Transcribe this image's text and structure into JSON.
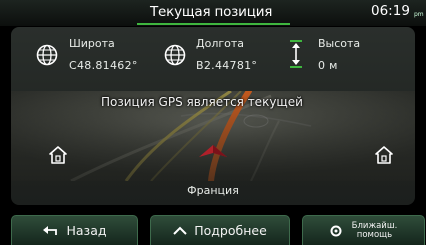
{
  "header": {
    "title": "Текущая позиция",
    "time": "06:19",
    "ampm": "pm"
  },
  "info": {
    "latitude": {
      "label": "Широта",
      "value": "C48.81462°",
      "icon": "globe-icon"
    },
    "longitude": {
      "label": "Долгота",
      "value": "B2.44781°",
      "icon": "globe-icon"
    },
    "altitude": {
      "label": "Высота",
      "value": "0 м",
      "icon": "altitude-arrows-icon"
    }
  },
  "map": {
    "status": "Позиция GPS является текущей",
    "country": "Франция",
    "left_icon": "home-icon",
    "right_icon": "home-icon",
    "position_icon": "vehicle-position-arrow-icon"
  },
  "buttons": {
    "back": {
      "label": "Назад",
      "icon": "back-arrow-icon"
    },
    "details": {
      "label": "Подробнее",
      "icon": "chevron-up-icon"
    },
    "nearby": {
      "label_line1": "Ближайш.",
      "label_line2": "помощь",
      "icon": "location-pin-icon"
    }
  },
  "colors": {
    "accent_green": "#3fb63f",
    "route_orange": "#e8641c",
    "position_red": "#b0202a"
  }
}
